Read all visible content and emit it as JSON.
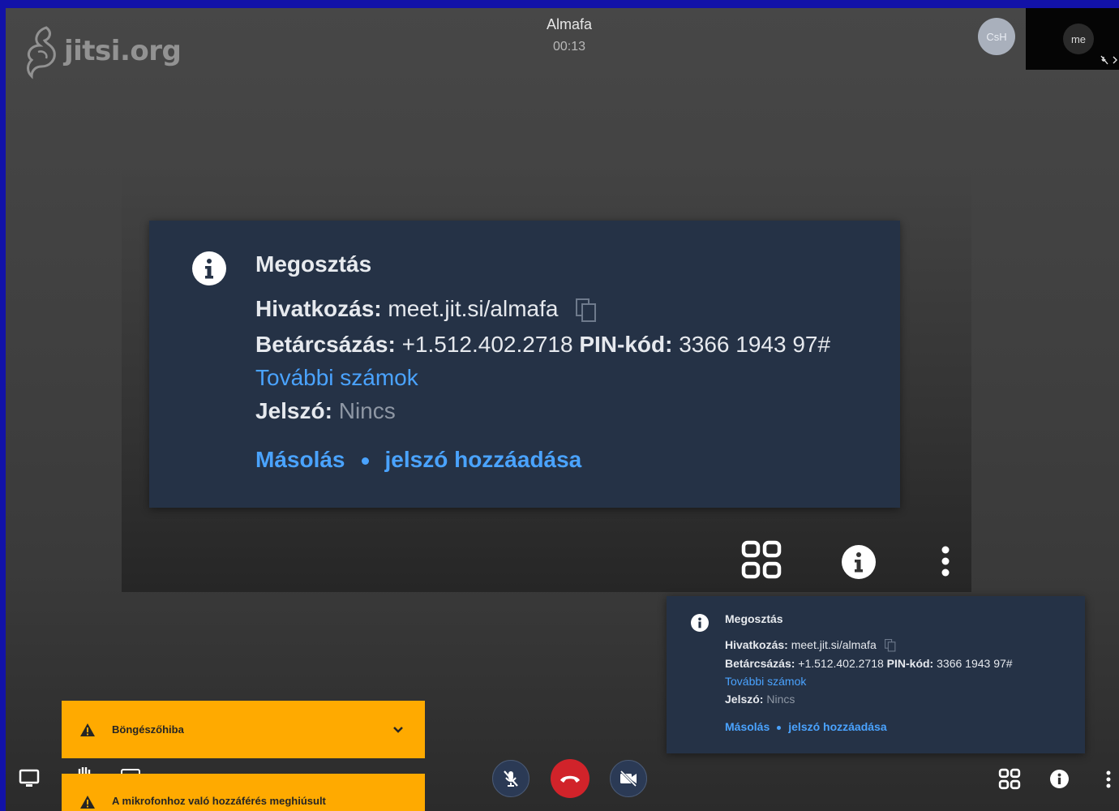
{
  "conference": {
    "logo_text": "jitsi.org",
    "subject": "Almafa",
    "timer": "00:13"
  },
  "participants": {
    "remote_initials": "CsH",
    "local_label": "me"
  },
  "invite_card": {
    "title": "Megosztás",
    "link_label": "Hivatkozás:",
    "link_value": "meet.jit.si/almafa",
    "dialin_label": "Betárcsázás:",
    "dialin_number": "+1.512.402.2718",
    "pin_label": "PIN-kód:",
    "pin_value": "3366 1943 97#",
    "more_numbers": "További számok",
    "password_label": "Jelszó:",
    "password_value": "Nincs",
    "copy_action": "Másolás",
    "add_password_action": "jelszó hozzáadása"
  },
  "notifications": [
    {
      "title": "Böngészőhiba"
    },
    {
      "title": "A mikrofonhoz való hozzáférés meghiúsult"
    }
  ],
  "colors": {
    "background_frame": "#1212a8",
    "card_bg": "#253246",
    "link": "#4aa3ff",
    "warning": "#ffaa00",
    "hangup": "#d1232a"
  },
  "icons": {
    "info": "info-icon",
    "copy": "copy-icon",
    "tile_view": "tile-view-icon",
    "more": "more-vertical-icon",
    "mic_off": "mic-off-icon",
    "hangup": "hangup-icon",
    "camera_off": "camera-off-icon",
    "warning": "warning-icon",
    "chevron": "chevron-down-icon",
    "screen_share": "screen-share-icon"
  }
}
